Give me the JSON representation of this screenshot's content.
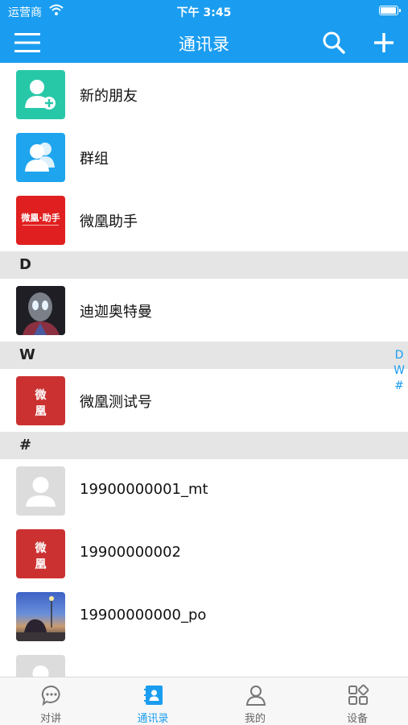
{
  "status_bar": {
    "carrier": "运营商",
    "time": "下午 3:45",
    "battery_level": 1.0
  },
  "nav": {
    "title": "通讯录"
  },
  "top_items": [
    {
      "label": "新的朋友",
      "icon": "new-friend-icon"
    },
    {
      "label": "群组",
      "icon": "group-icon"
    },
    {
      "label": "微凰助手",
      "icon": "assistant-logo",
      "logo_text": "微凰·助手"
    }
  ],
  "sections": [
    {
      "letter": "D",
      "contacts": [
        {
          "name": "迪迦奥特曼"
        }
      ]
    },
    {
      "letter": "W",
      "contacts": [
        {
          "name": "微凰测试号",
          "avatar_text": "微\n凰"
        }
      ]
    },
    {
      "letter": "#",
      "contacts": [
        {
          "name": "19900000001_mt"
        },
        {
          "name": "19900000002",
          "avatar_text": "微\n凰"
        },
        {
          "name": "19900000000_po"
        }
      ]
    }
  ],
  "index_bar": [
    "D",
    "W",
    "#"
  ],
  "tabs": [
    {
      "label": "对讲",
      "icon": "chat-bubble-icon",
      "active": false
    },
    {
      "label": "通讯录",
      "icon": "contacts-book-icon",
      "active": true
    },
    {
      "label": "我的",
      "icon": "person-icon",
      "active": false
    },
    {
      "label": "设备",
      "icon": "device-grid-icon",
      "active": false
    }
  ],
  "colors": {
    "primary": "#1a9df0",
    "section_bg": "#e5e5e5",
    "tab_bg": "#f7f7f7"
  }
}
